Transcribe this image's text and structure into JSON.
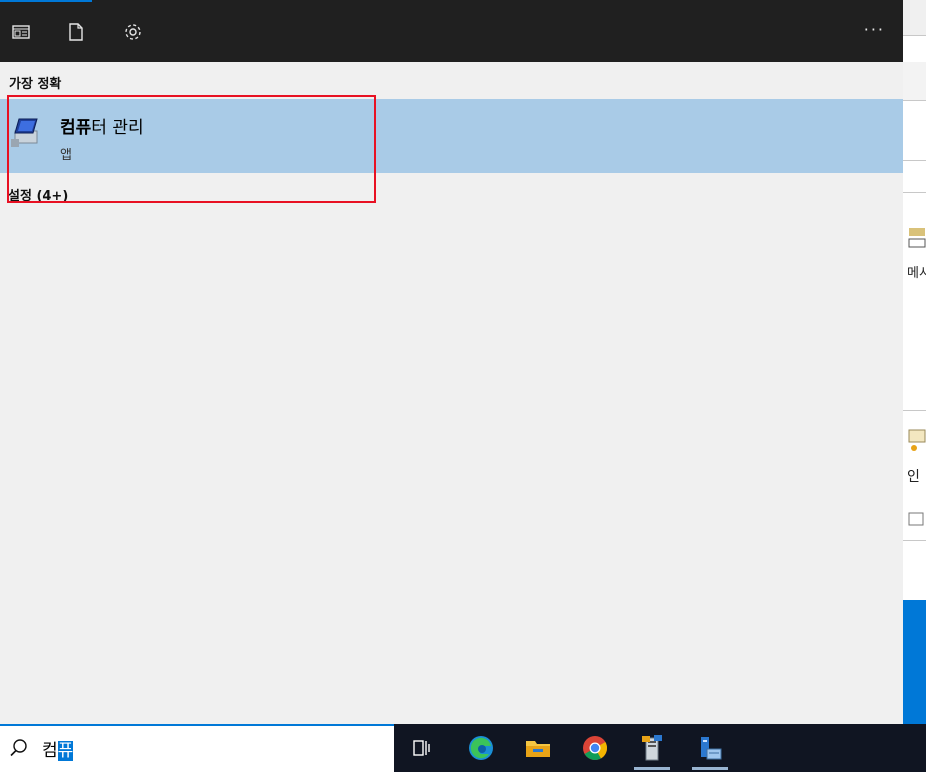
{
  "topbar": {
    "icons": [
      "apps-icon",
      "document-icon",
      "settings-icon"
    ],
    "more_label": "···"
  },
  "best_match": {
    "title": "가장 정확",
    "app_name_bold": "컴퓨",
    "app_name_rest": "터 관리",
    "app_kind": "앱"
  },
  "settings_section": {
    "title": "설정 (4+)"
  },
  "background_window": {
    "text_1": "메시",
    "text_2": "인"
  },
  "search": {
    "query_prefix": "컴",
    "query_selected": "퓨"
  },
  "taskbar": {
    "items": [
      "task-view-icon",
      "edge-icon",
      "file-explorer-icon",
      "chrome-icon",
      "server-manager-icon",
      "computer-management-icon"
    ]
  },
  "colors": {
    "accent": "#0078d7",
    "highlight": "#a9cbe7",
    "annotation": "#e81123",
    "topbar": "#202020",
    "taskbar": "#101522"
  }
}
